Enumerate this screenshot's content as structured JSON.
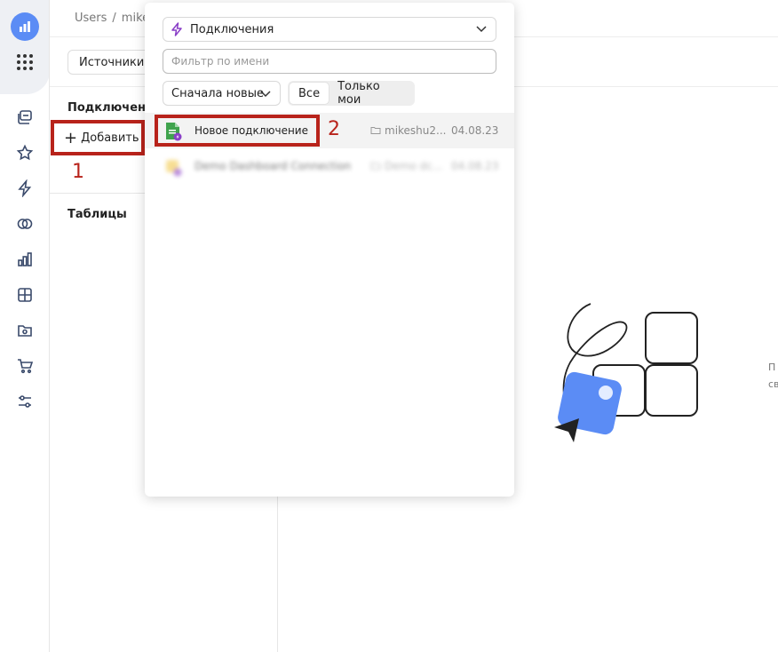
{
  "breadcrumb": {
    "items": [
      "Users",
      "mike"
    ]
  },
  "header": {
    "sources_button": "Источники"
  },
  "panel": {
    "connections_title": "Подключения",
    "add_button": "Добавить",
    "tables_title": "Таблицы"
  },
  "annotations": {
    "step1": "1",
    "step2": "2"
  },
  "popup": {
    "type_select": "Подключения",
    "filter_placeholder": "Фильтр по имени",
    "sort_select": "Сначала новые",
    "scope_tabs": [
      {
        "label": "Все",
        "active": true
      },
      {
        "label": "Только мои",
        "active": false
      }
    ],
    "rows": [
      {
        "name": "Новое подключение",
        "folder": "mikeshu2...",
        "date": "04.08.23"
      },
      {
        "name": "Demo Dashboard Connection",
        "folder": "Demo dc...",
        "date": "04.08.23"
      }
    ]
  },
  "right_cut": [
    "П",
    "св"
  ],
  "colors": {
    "accent": "#5b8cf5",
    "annotation": "#b8231b",
    "sheet_green": "#3fa34d",
    "bolt_purple": "#8a3fc7"
  }
}
